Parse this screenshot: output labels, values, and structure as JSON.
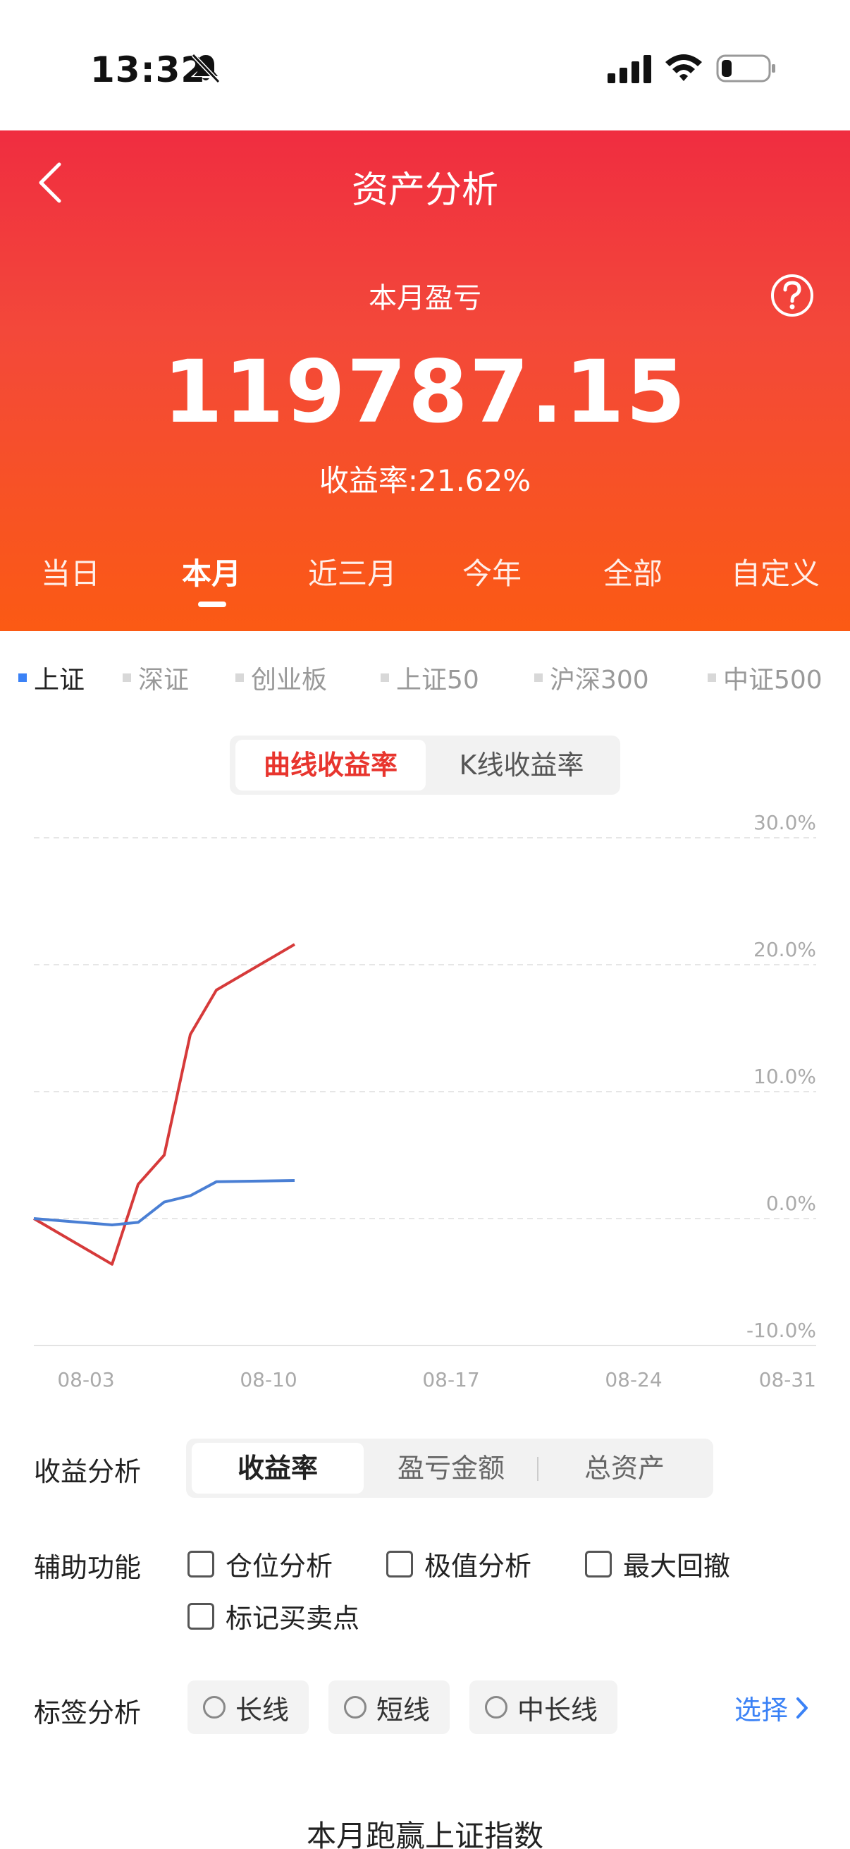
{
  "status_bar": {
    "time": "13:32"
  },
  "header": {
    "title": "资产分析",
    "pl_label": "本月盈亏",
    "pl_value": "119787.15",
    "rate": "收益率:21.62%",
    "tabs": [
      "当日",
      "本月",
      "近三月",
      "今年",
      "全部",
      "自定义"
    ],
    "active_tab": "本月"
  },
  "indices": [
    "上证",
    "深证",
    "创业板",
    "上证50",
    "沪深300",
    "中证500"
  ],
  "chart_mode": {
    "items": [
      "曲线收益率",
      "K线收益率"
    ],
    "active": "曲线收益率"
  },
  "colors": {
    "accent": "#e8352e",
    "index_line": "#4a7fd4",
    "header_top": "#f02d40",
    "header_bottom": "#fb5a14"
  },
  "chart_data": {
    "type": "line",
    "x_ticks": [
      "08-03",
      "08-10",
      "08-17",
      "08-24",
      "08-31"
    ],
    "y_ticks": [
      "30.0%",
      "20.0%",
      "10.0%",
      "0.0%",
      "-10.0%"
    ],
    "ylim": [
      -10,
      30
    ],
    "grid": true,
    "series": [
      {
        "color": "#d63a3a",
        "points": [
          [
            0,
            0.0
          ],
          [
            3,
            -3.6
          ],
          [
            4,
            2.7
          ],
          [
            5,
            5.0
          ],
          [
            6,
            14.5
          ],
          [
            7,
            18.0
          ],
          [
            10,
            21.6
          ]
        ]
      },
      {
        "color": "#4a7fd4",
        "points": [
          [
            0,
            0.0
          ],
          [
            3,
            -0.5
          ],
          [
            4,
            -0.3
          ],
          [
            5,
            1.3
          ],
          [
            6,
            1.8
          ],
          [
            7,
            2.9
          ],
          [
            10,
            3.0
          ]
        ]
      }
    ]
  },
  "analysis": {
    "label": "收益分析",
    "items": [
      "收益率",
      "盈亏金额",
      "总资产"
    ],
    "active": "收益率"
  },
  "aux": {
    "label": "辅助功能",
    "items": [
      "仓位分析",
      "极值分析",
      "最大回撤",
      "标记买卖点"
    ]
  },
  "tags": {
    "label": "标签分析",
    "items": [
      "长线",
      "短线",
      "中长线"
    ],
    "select": "选择"
  },
  "footer_title": "本月跑赢上证指数"
}
